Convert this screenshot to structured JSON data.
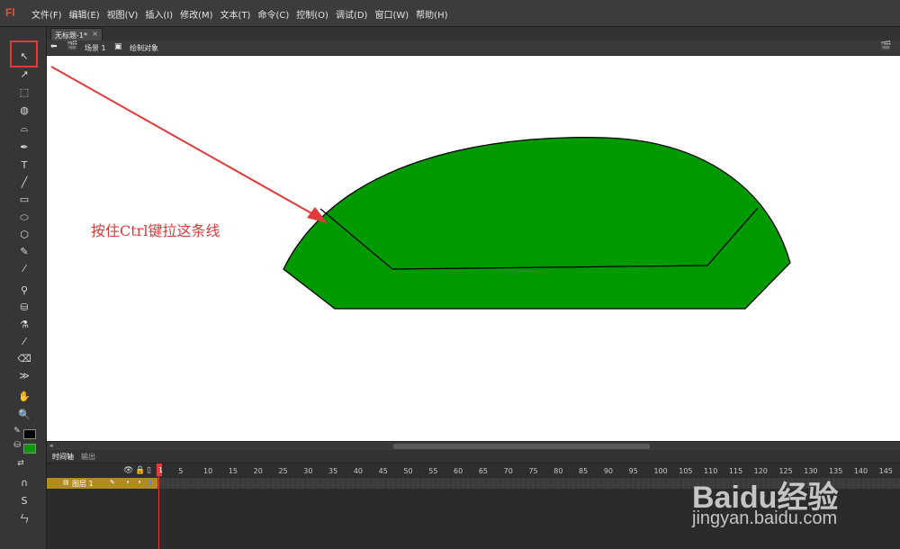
{
  "app": {
    "logo": "Fl"
  },
  "menu": [
    "文件(F)",
    "编辑(E)",
    "视图(V)",
    "插入(I)",
    "修改(M)",
    "文本(T)",
    "命令(C)",
    "控制(O)",
    "调试(D)",
    "窗口(W)",
    "帮助(H)"
  ],
  "document_tab": {
    "title": "无标题-1*",
    "close": "×"
  },
  "breadcrumb": {
    "scene": "场景 1",
    "object": "绘制对象"
  },
  "tools": [
    {
      "name": "selection-tool-icon",
      "glyph": "↖"
    },
    {
      "name": "subselection-tool-icon",
      "glyph": "↗"
    },
    {
      "name": "free-transform-tool-icon",
      "glyph": "⬚"
    },
    {
      "name": "3d-rotation-tool-icon",
      "glyph": "◍"
    },
    {
      "name": "lasso-tool-icon",
      "glyph": "⌓"
    },
    {
      "name": "pen-tool-icon",
      "glyph": "✒"
    },
    {
      "name": "text-tool-icon",
      "glyph": "T"
    },
    {
      "name": "line-tool-icon",
      "glyph": "╱"
    },
    {
      "name": "rectangle-tool-icon",
      "glyph": "▭"
    },
    {
      "name": "oval-tool-icon",
      "glyph": "⬭"
    },
    {
      "name": "polystar-tool-icon",
      "glyph": "⬡"
    },
    {
      "name": "pencil-tool-icon",
      "glyph": "✎"
    },
    {
      "name": "brush-tool-icon",
      "glyph": "⁄"
    },
    {
      "name": "bone-tool-icon",
      "glyph": "⚲"
    },
    {
      "name": "paint-bucket-tool-icon",
      "glyph": "⛁"
    },
    {
      "name": "ink-bottle-tool-icon",
      "glyph": "⚗"
    },
    {
      "name": "eyedropper-tool-icon",
      "glyph": "⁄"
    },
    {
      "name": "eraser-tool-icon",
      "glyph": "⌫"
    },
    {
      "name": "width-tool-icon",
      "glyph": "≫"
    },
    {
      "name": "hand-tool-icon",
      "glyph": "✋"
    },
    {
      "name": "zoom-tool-icon",
      "glyph": "🔍"
    }
  ],
  "colors": {
    "stroke": "#000000",
    "fill": "#009900",
    "annotation": "#e03a3a",
    "layer_highlight": "#b08c1c"
  },
  "annotation": {
    "text": "按住Ctrl键拉这条线"
  },
  "panels": {
    "timeline_tab": "时间轴",
    "output_tab": "输出"
  },
  "timeline": {
    "frame_labels": [
      "1",
      "5",
      "10",
      "15",
      "20",
      "25",
      "30",
      "35",
      "40",
      "45",
      "50",
      "55",
      "60",
      "65",
      "70",
      "75",
      "80",
      "85",
      "90",
      "95",
      "100",
      "105",
      "110",
      "115",
      "120",
      "125",
      "130",
      "135",
      "140",
      "145"
    ],
    "current_frame": "1",
    "layer_name": "图层 1"
  },
  "watermark": {
    "logo": "Baidu经验",
    "url": "jingyan.baidu.com"
  }
}
